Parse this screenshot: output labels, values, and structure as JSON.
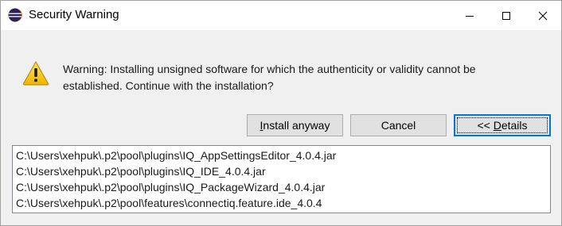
{
  "window": {
    "title": "Security Warning"
  },
  "message": {
    "line1": "Warning: Installing unsigned software for which the authenticity or validity cannot be",
    "line2": "established. Continue with the installation?"
  },
  "buttons": {
    "install_prefix": "I",
    "install_rest": "nstall anyway",
    "cancel": "Cancel",
    "details_prefix": "<< ",
    "details_underlined": "D",
    "details_rest": "etails"
  },
  "files": [
    "C:\\Users\\xehpuk\\.p2\\pool\\plugins\\IQ_AppSettingsEditor_4.0.4.jar",
    "C:\\Users\\xehpuk\\.p2\\pool\\plugins\\IQ_IDE_4.0.4.jar",
    "C:\\Users\\xehpuk\\.p2\\pool\\plugins\\IQ_PackageWizard_4.0.4.jar",
    "C:\\Users\\xehpuk\\.p2\\pool\\features\\connectiq.feature.ide_4.0.4"
  ],
  "icons": {
    "app": "eclipse-icon",
    "warning": "warning-triangle-icon",
    "minimize": "minimize-icon",
    "maximize": "maximize-icon",
    "close": "close-icon"
  },
  "colors": {
    "dialog_bg": "#f0f0f0",
    "focus_accent": "#0078d7",
    "warning_yellow": "#f5c518"
  }
}
